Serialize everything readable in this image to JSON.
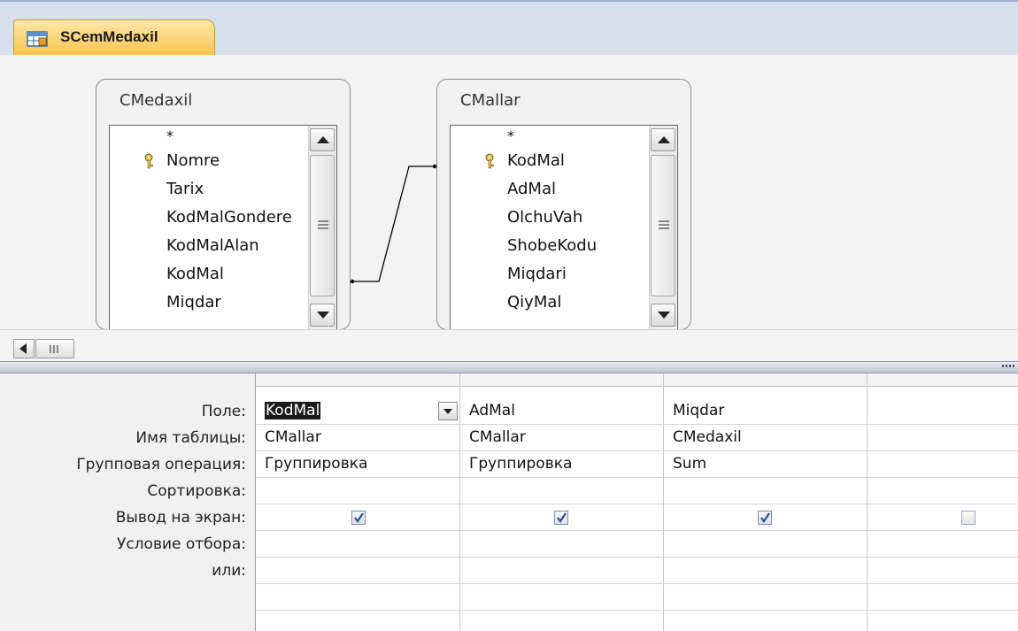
{
  "tab": {
    "title": "SCemMedaxil"
  },
  "tables": [
    {
      "name": "CMedaxil",
      "fields": [
        "*",
        "Nomre",
        "Tarix",
        "KodMalGondere",
        "KodMalAlan",
        "KodMal",
        "Miqdar"
      ],
      "key_index": 1
    },
    {
      "name": "CMallar",
      "fields": [
        "*",
        "KodMal",
        "AdMal",
        "OlchuVah",
        "ShobeKodu",
        "Miqdari",
        "QiyMal"
      ],
      "key_index": 1
    }
  ],
  "grid": {
    "row_labels": {
      "field": "Поле:",
      "table": "Имя таблицы:",
      "total": "Групповая операция:",
      "sort": "Сортировка:",
      "show": "Вывод на экран:",
      "criteria": "Условие отбора:",
      "or": "или:"
    },
    "columns": [
      {
        "field": "KodMal",
        "table": "CMallar",
        "total": "Группировка",
        "sort": "",
        "show": true
      },
      {
        "field": "AdMal",
        "table": "CMallar",
        "total": "Группировка",
        "sort": "",
        "show": true
      },
      {
        "field": "Miqdar",
        "table": "CMedaxil",
        "total": "Sum",
        "sort": "",
        "show": true
      },
      {
        "field": "",
        "table": "",
        "total": "",
        "sort": "",
        "show": false
      }
    ]
  },
  "colors": {
    "tab_active": "#f8c24d",
    "tabstrip": "#d6dfec",
    "canvas": "#f3f3f3"
  }
}
